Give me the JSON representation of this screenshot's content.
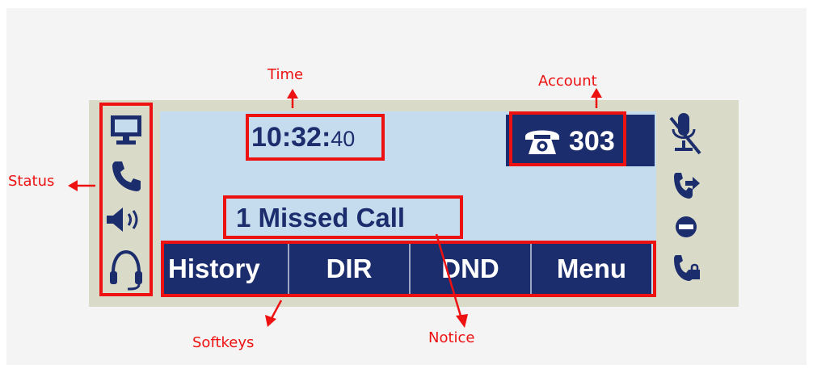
{
  "callouts": {
    "time": "Time",
    "account": "Account",
    "status": "Status",
    "softkeys": "Softkeys",
    "notice": "Notice"
  },
  "screen": {
    "time_hm": "10:32:",
    "time_s": "40",
    "account_number": "303",
    "notice": "1 Missed Call"
  },
  "softkeys": [
    "History",
    "DIR",
    "DND",
    "Menu"
  ],
  "status_icons": [
    "network-icon",
    "phone-icon",
    "speaker-icon",
    "headset-icon"
  ],
  "feature_icons": [
    "mute-icon",
    "call-forward-icon",
    "do-not-disturb-icon",
    "locked-handset-icon"
  ],
  "colors": {
    "callout_red": "#ee1111",
    "screen_blue": "#c5dcef",
    "navy": "#1c2d6d",
    "bezel": "#d9dac8"
  }
}
